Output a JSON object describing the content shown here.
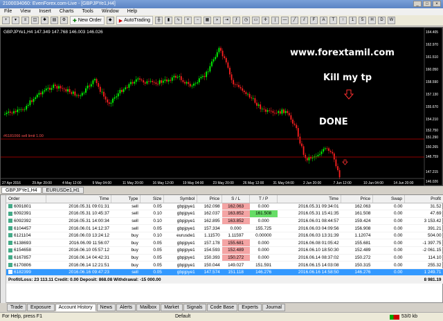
{
  "window": {
    "title": "2100034060: EvenForex.com-Live - [GBPJPYe1,H4]"
  },
  "menu": [
    "File",
    "View",
    "Insert",
    "Charts",
    "Tools",
    "Window",
    "Help"
  ],
  "toolbar": {
    "new_order": "New Order",
    "auto_trading": "AutoTrading"
  },
  "chart": {
    "header": "GBPJPYe1,H4  147.349 147.768 146.003 146.026",
    "overlay_site": "www.forextamil.com",
    "overlay_kill": "Kill my tp",
    "overlay_done": "DONE",
    "order_line": "#6181066 sell limit 1.00",
    "price_labels": [
      "164.405",
      "162.970",
      "161.510",
      "160.050",
      "158.590",
      "157.130",
      "155.670",
      "154.210",
      "152.750",
      "151.290",
      "150.265",
      "148.759",
      "147.215",
      "146.026"
    ],
    "time_labels": [
      "27 Apr 2016",
      "29 Apr 20:00",
      "4 May 12:00",
      "9 May 04:00",
      "11 May 20:00",
      "16 May 12:00",
      "19 May 04:00",
      "23 May 20:00",
      "26 May 12:00",
      "31 May 04:00",
      "2 Jun 20:00",
      "7 Jun 12:00",
      "10 Jun 04:00",
      "14 Jun 20:00"
    ],
    "colors": {
      "up": "#00ff00",
      "down": "#ff2020",
      "sell_line": "#d00000",
      "order_line": "#ff3030",
      "text": "#ffffff"
    }
  },
  "chart_tabs": [
    "GBPJPYe1,H4",
    "EURUSDe1,H1"
  ],
  "terminal": {
    "columns": [
      "Order",
      "Time",
      "Type",
      "Size",
      "Symbol",
      "Price",
      "S / L",
      "T / P",
      "Time",
      "Price",
      "Swap",
      "Profit"
    ],
    "rows": [
      [
        "6091801",
        "2016.05.31 09:01:31",
        "sell",
        "0.05",
        "gbpjpye1",
        "162.098",
        "162.063",
        "0.000",
        "2016.05.31 09:34:01",
        "162.063",
        "0.00",
        "31.52"
      ],
      [
        "6092391",
        "2016.05.31 10:45:37",
        "sell",
        "0.10",
        "gbpjpye1",
        "162.037",
        "163.852",
        "161.508",
        "2016.05.31 15:41:35",
        "161.508",
        "0.00",
        "47.69"
      ],
      [
        "6092392",
        "2016.05.31 14:00:34",
        "sell",
        "0.10",
        "gbpjpye1",
        "162.895",
        "163.852",
        "0.000",
        "2016.06.01 08:44:57",
        "159.424",
        "0.00",
        "3 153.42"
      ],
      [
        "6104457",
        "2016.06.01 14:12:37",
        "sell",
        "0.05",
        "gbpjpye1",
        "157.334",
        "0.000",
        "155.725",
        "2016.06.03 04:09:56",
        "156.908",
        "0.00",
        "391.21"
      ],
      [
        "6121104",
        "2016.06.03 13:24:12",
        "buy",
        "0.10",
        "eurusde1",
        "1.11570",
        "1.11597",
        "0.00000",
        "2016.06.03 13:31:39",
        "1.12074",
        "0.00",
        "504.00"
      ],
      [
        "6138693",
        "2016.06.09 11:56:07",
        "buy",
        "0.05",
        "gbpjpye1",
        "157.178",
        "155.681",
        "0.000",
        "2016.06.08 01:05:42",
        "155.681",
        "0.00",
        "-1 397.75"
      ],
      [
        "6154658",
        "2016.06.10 05:57:12",
        "buy",
        "0.05",
        "gbpjpye1",
        "154.593",
        "152.489",
        "0.000",
        "2016.06.10 18:50:30",
        "152.489",
        "0.00",
        "-2 061.15"
      ],
      [
        "6167857",
        "2016.06.14 04:42:31",
        "buy",
        "0.05",
        "gbpjpye1",
        "150.393",
        "150.272",
        "0.000",
        "2016.06.14 08:37:02",
        "150.272",
        "0.00",
        "114.10"
      ],
      [
        "6170806",
        "2016.06.14 12:21:51",
        "buy",
        "0.05",
        "gbpjpye1",
        "150.044",
        "149.027",
        "151.591",
        "2016.06.15 14:03:08",
        "150.315",
        "0.00",
        "255.32"
      ],
      [
        "6182399",
        "2016.06.16 09:47:23",
        "sell",
        "0.05",
        "gbpjpye1",
        "147.574",
        "151.118",
        "146.276",
        "2016.06.16 14:58:50",
        "146.276",
        "0.00",
        "1 249.71"
      ]
    ],
    "highlights": {
      "sl": [
        0,
        1,
        2,
        5,
        6,
        7
      ],
      "tp": [
        1,
        9
      ]
    },
    "selected_row": 9,
    "total": {
      "label": "Profit/Loss: 23 113.11  Credit: 0.00  Deposit: 868.08  Withdrawal: -15 000.00",
      "value": "8 981.19"
    }
  },
  "terminal_tabs": [
    "Trade",
    "Exposure",
    "Account History",
    "News",
    "Alerts",
    "Mailbox",
    "Market",
    "Signals",
    "Code Base",
    "Experts",
    "Journal"
  ],
  "active_terminal_tab": "Account History",
  "status": {
    "help": "For Help, press F1",
    "profile": "Default",
    "traffic": "53/0 kb"
  }
}
